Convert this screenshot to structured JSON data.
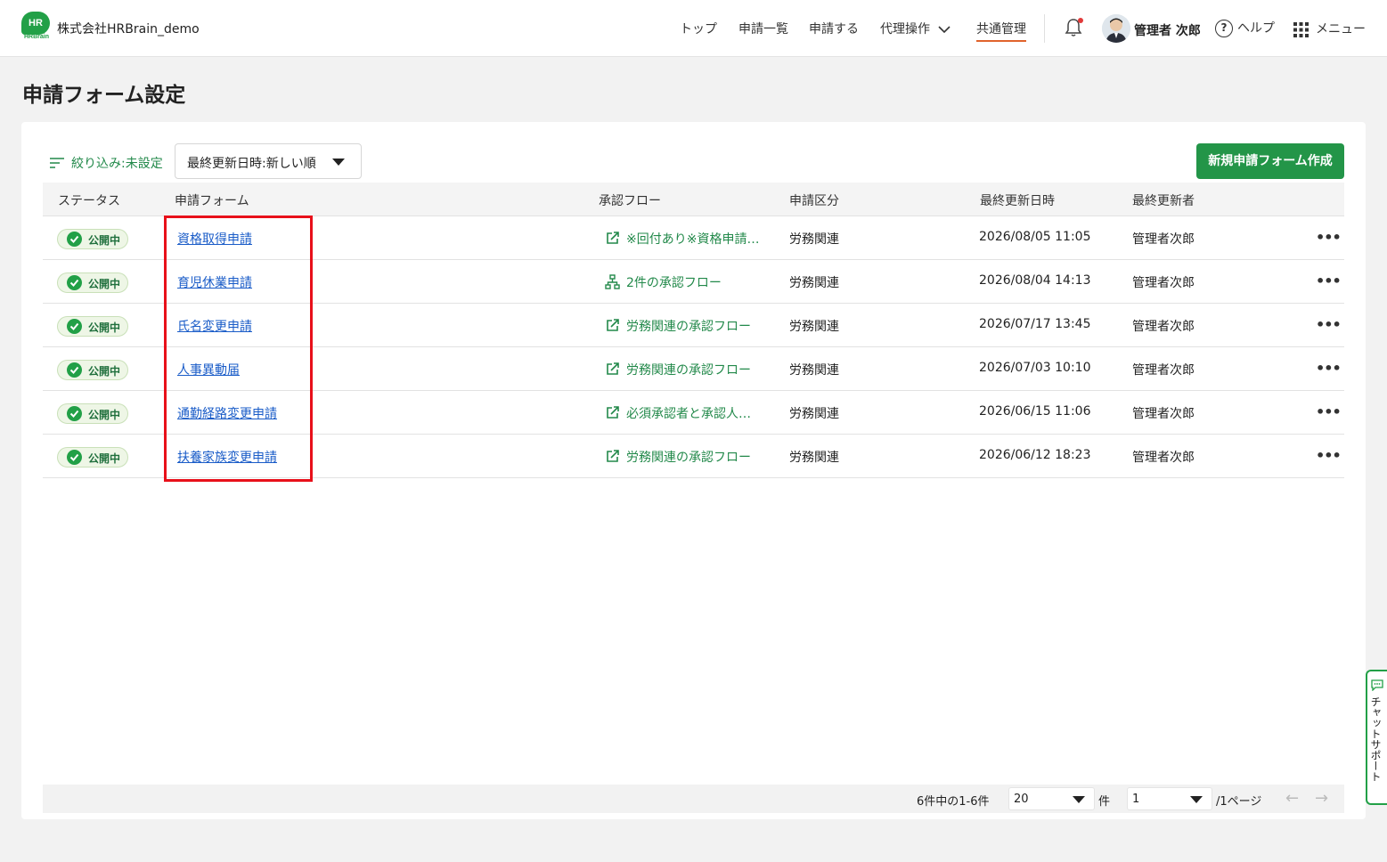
{
  "header": {
    "logo_text": "HR",
    "logo_sub": "HRBrain",
    "company": "株式会社HRBrain_demo",
    "nav": [
      {
        "label": "トップ"
      },
      {
        "label": "申請一覧"
      },
      {
        "label": "申請する"
      },
      {
        "label": "代理操作"
      },
      {
        "label": "共通管理"
      }
    ],
    "user_name": "管理者 次郎",
    "help_label": "ヘルプ",
    "menu_label": "メニュー",
    "accent_color": "#e0632c"
  },
  "page": {
    "title": "申請フォーム設定"
  },
  "toolbar": {
    "filter_label": "絞り込み:未設定",
    "sort_value": "最終更新日時:新しい順",
    "create_button": "新規申請フォーム作成",
    "brand_color": "#239548"
  },
  "table": {
    "columns": [
      "ステータス",
      "申請フォーム",
      "承認フロー",
      "申請区分",
      "最終更新日時",
      "最終更新者"
    ],
    "rows": [
      {
        "status": "公開中",
        "form": "資格取得申請",
        "flow_icon": "external-link-icon",
        "flow": "※回付あり※資格申請…",
        "category": "労務関連",
        "updated_at": "2026/08/05 11:05",
        "updated_by": "管理者次郎"
      },
      {
        "status": "公開中",
        "form": "育児休業申請",
        "flow_icon": "org-chart-icon",
        "flow": "2件の承認フロー",
        "category": "労務関連",
        "updated_at": "2026/08/04 14:13",
        "updated_by": "管理者次郎"
      },
      {
        "status": "公開中",
        "form": "氏名変更申請",
        "flow_icon": "external-link-icon",
        "flow": "労務関連の承認フロー",
        "category": "労務関連",
        "updated_at": "2026/07/17 13:45",
        "updated_by": "管理者次郎"
      },
      {
        "status": "公開中",
        "form": "人事異動届",
        "flow_icon": "external-link-icon",
        "flow": "労務関連の承認フロー",
        "category": "労務関連",
        "updated_at": "2026/07/03 10:10",
        "updated_by": "管理者次郎"
      },
      {
        "status": "公開中",
        "form": "通勤経路変更申請",
        "flow_icon": "external-link-icon",
        "flow": "必須承認者と承認人…",
        "category": "労務関連",
        "updated_at": "2026/06/15 11:06",
        "updated_by": "管理者次郎"
      },
      {
        "status": "公開中",
        "form": "扶養家族変更申請",
        "flow_icon": "external-link-icon",
        "flow": "労務関連の承認フロー",
        "category": "労務関連",
        "updated_at": "2026/06/12 18:23",
        "updated_by": "管理者次郎"
      }
    ],
    "more_label": "•••"
  },
  "pagination": {
    "count_text": "6件中の1-6件",
    "per_page": "20",
    "per_page_unit": "件",
    "page": "1",
    "page_total": "/1ページ",
    "prev": "←",
    "next": "→"
  },
  "chat_support": {
    "label": "チャットサポート"
  }
}
